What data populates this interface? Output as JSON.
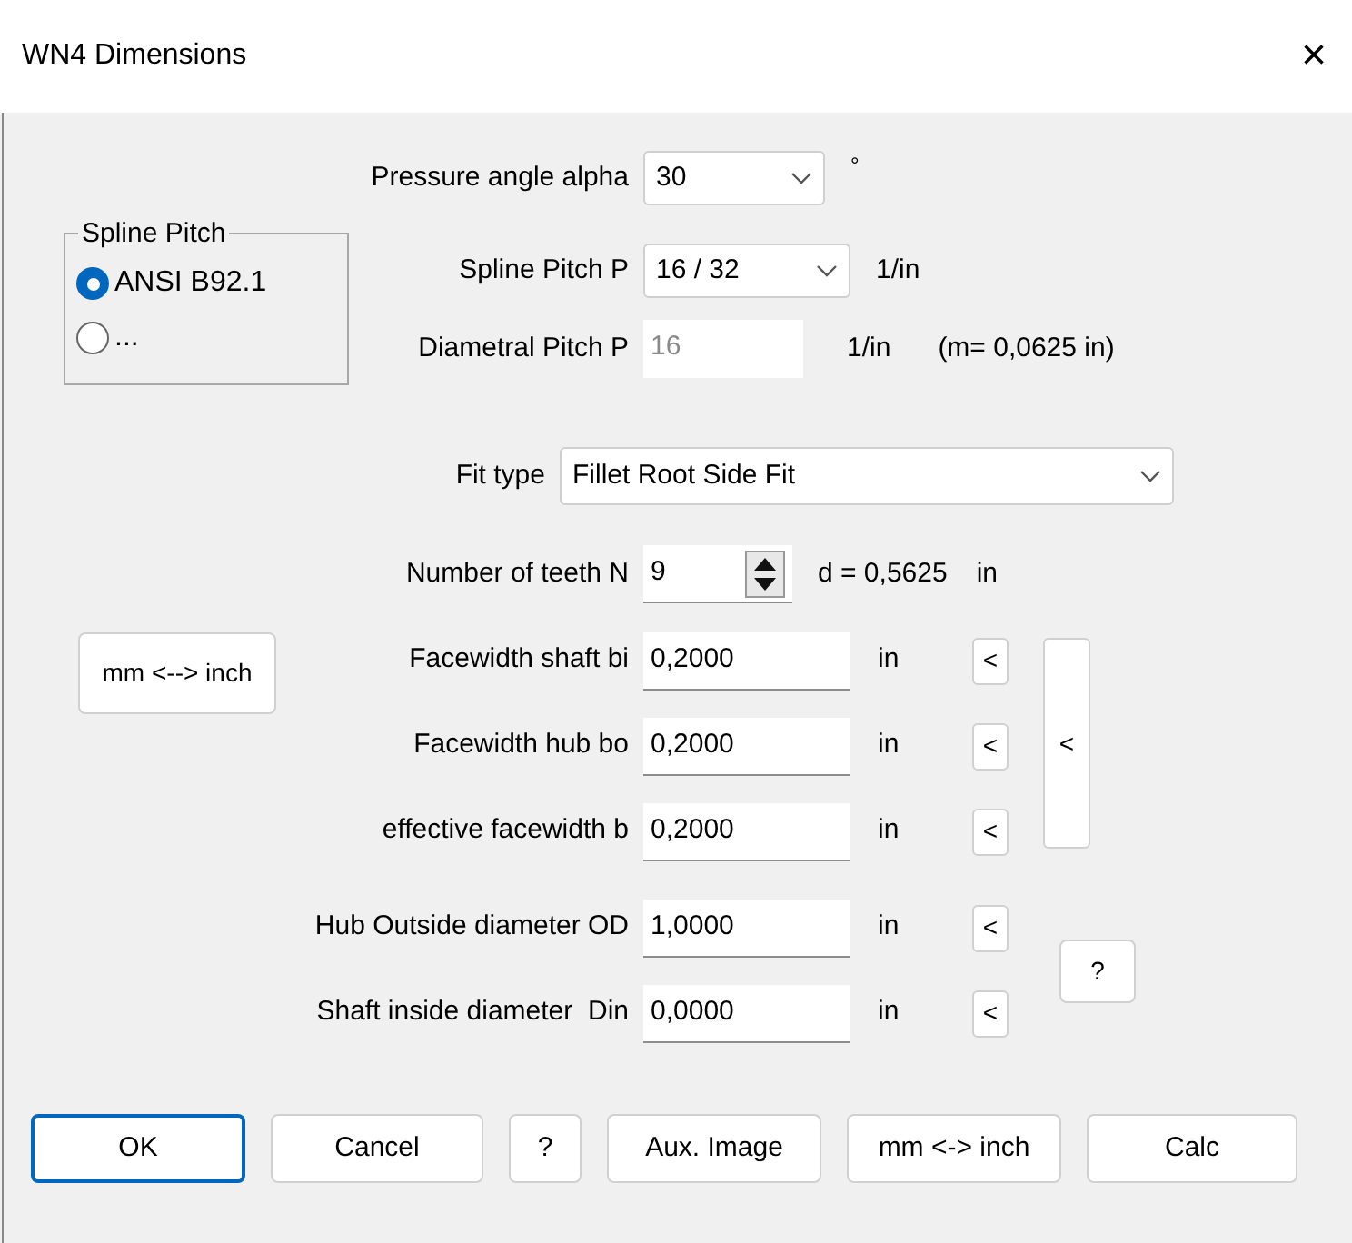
{
  "window": {
    "title": "WN4 Dimensions",
    "close": "×"
  },
  "pressure_angle": {
    "label": "Pressure angle alpha",
    "value": "30",
    "unit": "°"
  },
  "spline_pitch_group": {
    "title": "Spline Pitch",
    "options": [
      {
        "label": "ANSI B92.1",
        "selected": true
      },
      {
        "label": "...",
        "selected": false
      }
    ]
  },
  "spline_pitch": {
    "label": "Spline Pitch P",
    "value": "16 / 32",
    "unit": "1/in"
  },
  "diametral_pitch": {
    "label": "Diametral Pitch P",
    "value": "16",
    "unit": "1/in",
    "note": "(m= 0,0625 in)",
    "disabled": true
  },
  "fit_type": {
    "label": "Fit type",
    "value": "Fillet Root Side Fit"
  },
  "teeth": {
    "label": "Number of teeth N",
    "value": "9",
    "result": "d = 0,5625",
    "unit": "in"
  },
  "unit_toggle": "mm <--> inch",
  "facewidths": [
    {
      "label": "Facewidth shaft bi",
      "value": "0,2000",
      "unit": "in",
      "button": "<"
    },
    {
      "label": "Facewidth hub bo",
      "value": "0,2000",
      "unit": "in",
      "button": "<"
    },
    {
      "label": "effective facewidth b",
      "value": "0,2000",
      "unit": "in",
      "button": "<"
    }
  ],
  "facewidth_group_button": "<",
  "diameters": [
    {
      "label": "Hub Outside diameter OD",
      "value": "1,0000",
      "unit": "in",
      "button": "<"
    },
    {
      "label": "Shaft inside diameter  Din",
      "value": "0,0000",
      "unit": "in",
      "button": "<"
    }
  ],
  "help_button": "?",
  "buttons": [
    {
      "label": "OK",
      "default": true
    },
    {
      "label": "Cancel",
      "default": false
    },
    {
      "label": "?",
      "default": false
    },
    {
      "label": "Aux. Image",
      "default": false
    },
    {
      "label": "mm <-> inch",
      "default": false
    },
    {
      "label": "Calc",
      "default": false
    }
  ]
}
